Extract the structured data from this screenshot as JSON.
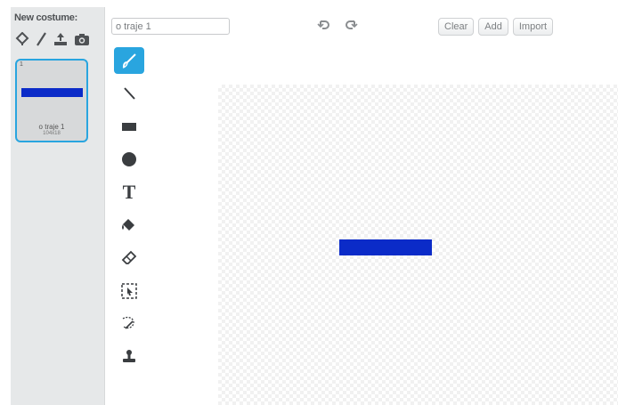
{
  "left_pane": {
    "new_costume_label": "New costume:",
    "new_icons": [
      "paint-brush-choose-icon",
      "pencil-paint-icon",
      "upload-icon",
      "camera-icon"
    ],
    "costume": {
      "number": "1",
      "name": "o traje 1",
      "size": "104x18",
      "thumb_color": "#0b2bc8",
      "selected_border": "#29a5df"
    }
  },
  "editor": {
    "costume_name_value": "o traje 1",
    "undo_icon": "undo-icon",
    "redo_icon": "redo-icon",
    "buttons": {
      "clear": "Clear",
      "add": "Add",
      "import": "Import"
    },
    "tools": [
      {
        "name": "brush-tool",
        "icon": "brush-icon",
        "selected": true
      },
      {
        "name": "line-tool",
        "icon": "line-icon",
        "selected": false
      },
      {
        "name": "rectangle-tool",
        "icon": "rectangle-icon",
        "selected": false
      },
      {
        "name": "ellipse-tool",
        "icon": "ellipse-icon",
        "selected": false
      },
      {
        "name": "text-tool",
        "icon": "text-icon",
        "label": "T",
        "selected": false
      },
      {
        "name": "fill-tool",
        "icon": "paint-bucket-icon",
        "selected": false
      },
      {
        "name": "eraser-tool",
        "icon": "eraser-icon",
        "selected": false
      },
      {
        "name": "select-tool",
        "icon": "select-icon",
        "selected": false
      },
      {
        "name": "remove-background-tool",
        "icon": "magic-wand-icon",
        "selected": false
      },
      {
        "name": "stamp-tool",
        "icon": "stamp-icon",
        "selected": false
      }
    ],
    "canvas_shape_color": "#0b2bc8"
  }
}
